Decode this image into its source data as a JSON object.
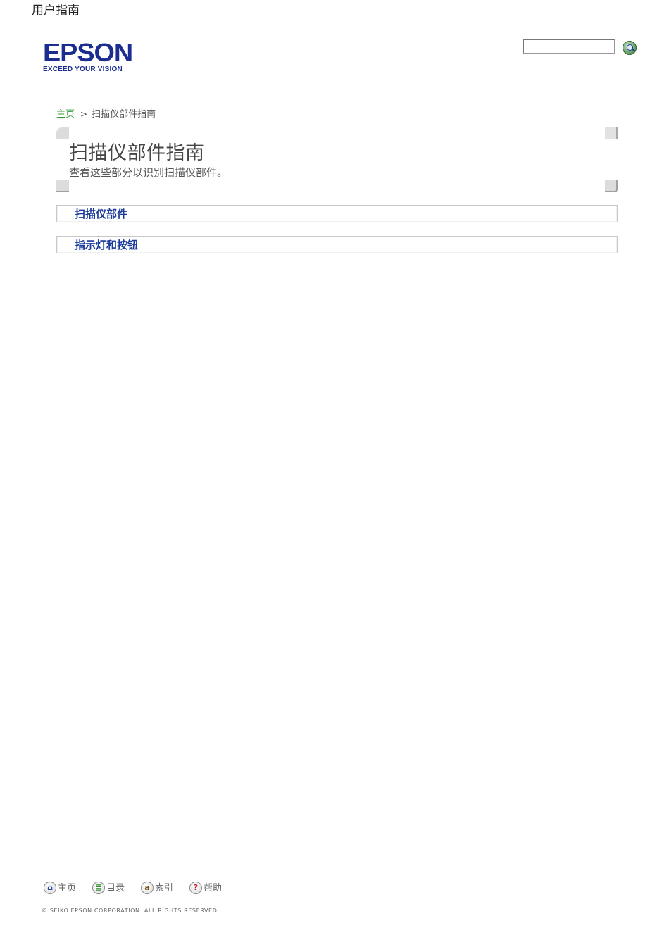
{
  "document_title": "用户指南",
  "logo": {
    "wordmark": "EPSON",
    "tagline": "EXCEED YOUR VISION",
    "brand_color": "#1b2d8f"
  },
  "search": {
    "value": "",
    "icon": "search-icon"
  },
  "breadcrumb": {
    "home": "主页",
    "separator": ">",
    "current": "扫描仪部件指南"
  },
  "header": {
    "title": "扫描仪部件指南",
    "description": "查看这些部分以识别扫描仪部件。"
  },
  "sections": [
    {
      "label": "扫描仪部件"
    },
    {
      "label": "指示灯和按钮"
    }
  ],
  "footer_nav": [
    {
      "icon": "home-icon",
      "glyph": "⌂",
      "label": "主页"
    },
    {
      "icon": "contents-icon",
      "glyph": "≣",
      "label": "目录"
    },
    {
      "icon": "index-icon",
      "glyph": "a",
      "label": "索引"
    },
    {
      "icon": "help-icon",
      "glyph": "?",
      "label": "帮助"
    }
  ],
  "copyright": "© SEIKO EPSON CORPORATION. ALL RIGHTS RESERVED.",
  "colors": {
    "link_blue": "#1a3a9a",
    "breadcrumb_green": "#3a9a3a"
  }
}
